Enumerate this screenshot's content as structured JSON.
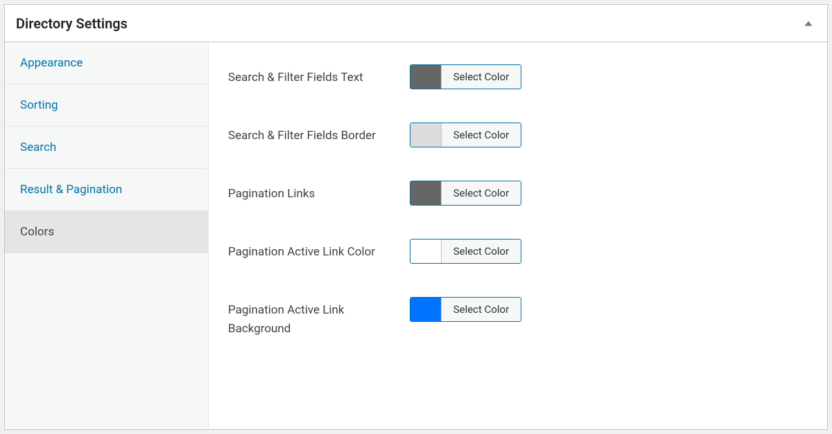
{
  "panel": {
    "title": "Directory Settings"
  },
  "sidebar": {
    "items": [
      {
        "label": "Appearance",
        "active": false
      },
      {
        "label": "Sorting",
        "active": false
      },
      {
        "label": "Search",
        "active": false
      },
      {
        "label": "Result & Pagination",
        "active": false
      },
      {
        "label": "Colors",
        "active": true
      }
    ]
  },
  "fields": [
    {
      "label": "Search & Filter Fields Text",
      "color": "#666666",
      "button": "Select Color"
    },
    {
      "label": "Search & Filter Fields Border",
      "color": "#dddddd",
      "button": "Select Color"
    },
    {
      "label": "Pagination Links",
      "color": "#666666",
      "button": "Select Color"
    },
    {
      "label": "Pagination Active Link Color",
      "color": "#ffffff",
      "button": "Select Color"
    },
    {
      "label": "Pagination Active Link Background",
      "color": "#0073ff",
      "button": "Select Color"
    }
  ]
}
